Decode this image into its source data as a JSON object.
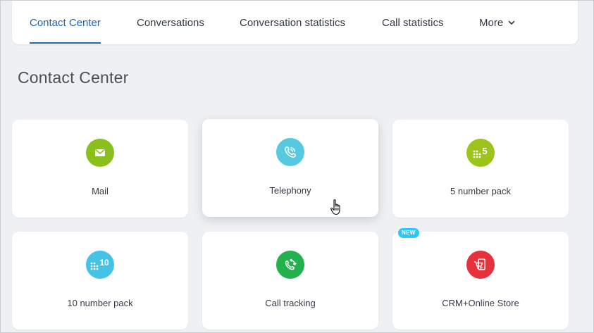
{
  "nav": {
    "tabs": [
      {
        "label": "Contact Center",
        "active": true
      },
      {
        "label": "Conversations",
        "active": false
      },
      {
        "label": "Conversation statistics",
        "active": false
      },
      {
        "label": "Call statistics",
        "active": false
      },
      {
        "label": "More",
        "active": false
      }
    ]
  },
  "page": {
    "title": "Contact Center"
  },
  "cards": [
    {
      "label": "Mail",
      "icon": "mail-icon",
      "color": "#8bbf1b"
    },
    {
      "label": "Telephony",
      "icon": "phone-icon",
      "color": "#56c9e0"
    },
    {
      "label": "5 number pack",
      "icon": "dialpad-5-icon",
      "color": "#9cc41a"
    },
    {
      "label": "10 number pack",
      "icon": "dialpad-10-icon",
      "color": "#45c3e6"
    },
    {
      "label": "Call tracking",
      "icon": "call-tracking-icon",
      "color": "#23b14d"
    },
    {
      "label": "CRM+Online Store",
      "icon": "store-icon",
      "color": "#e5323c",
      "badge": "NEW"
    }
  ],
  "colors": {
    "accent": "#2067b0",
    "background": "#eef0f3"
  }
}
